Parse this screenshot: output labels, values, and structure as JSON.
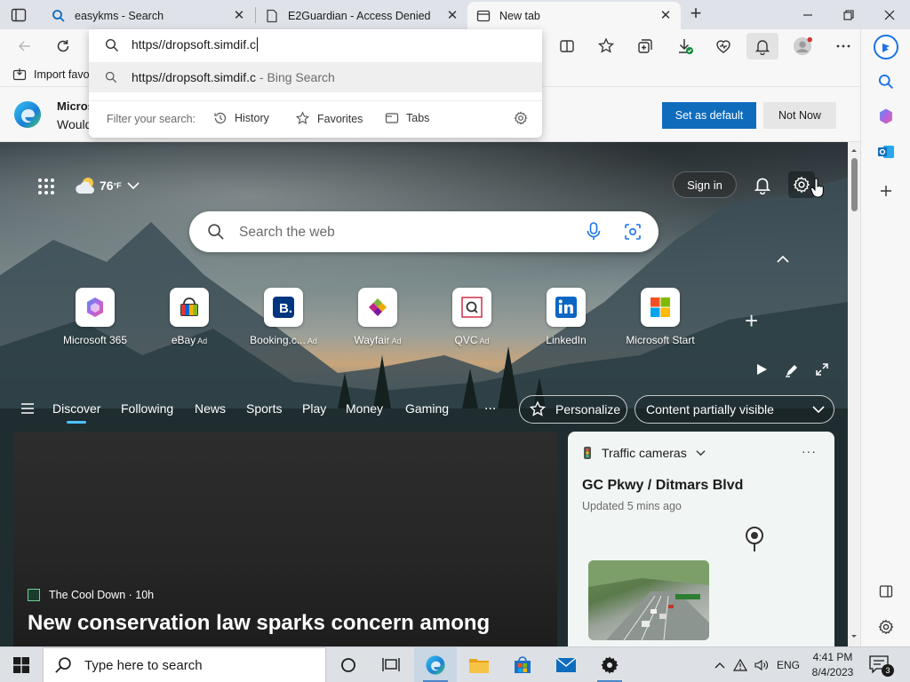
{
  "tabs": [
    {
      "label": "easykms - Search",
      "active": false
    },
    {
      "label": "E2Guardian - Access Denied",
      "active": false
    },
    {
      "label": "New tab",
      "active": true
    }
  ],
  "address": {
    "value": "https//dropsoft.simdif.c",
    "suggestion": "https//dropsoft.simdif.c",
    "suggestion_suffix": " - Bing Search",
    "filter_label": "Filter your search:",
    "filters": [
      "History",
      "Favorites",
      "Tabs"
    ]
  },
  "favorites_bar": {
    "import_label": "Import favo"
  },
  "banner": {
    "title": "Micros",
    "text": "Would",
    "set_default": "Set as default",
    "not_now": "Not Now"
  },
  "page": {
    "weather_temp": "76",
    "weather_unit": "°F",
    "sign_in": "Sign in",
    "search_placeholder": "Search the web",
    "tiles": [
      {
        "name": "Microsoft 365",
        "ad": ""
      },
      {
        "name": "eBay",
        "ad": "Ad"
      },
      {
        "name": "Booking.c...",
        "ad": "Ad"
      },
      {
        "name": "Wayfair",
        "ad": "Ad"
      },
      {
        "name": "QVC",
        "ad": "Ad"
      },
      {
        "name": "LinkedIn",
        "ad": ""
      },
      {
        "name": "Microsoft Start",
        "ad": ""
      }
    ],
    "feed_tabs": [
      "Discover",
      "Following",
      "News",
      "Sports",
      "Play",
      "Money",
      "Gaming"
    ],
    "feed_more": "...",
    "personalize": "Personalize",
    "content_visibility": "Content partially visible"
  },
  "news": {
    "source": "The Cool Down · 10h",
    "headline": "New conservation law sparks concern among"
  },
  "traffic": {
    "title": "Traffic cameras",
    "location": "GC Pkwy / Ditmars Blvd",
    "updated": "Updated 5 mins ago",
    "more": "···"
  },
  "taskbar": {
    "search_placeholder": "Type here to search",
    "language": "ENG",
    "time": "4:41 PM",
    "date": "8/4/2023",
    "notifications": "3"
  },
  "colors": {
    "accent": "#0f6cbd",
    "active_tab_indicator": "#4cc2ff",
    "titlebar": "#dfe3e9",
    "taskbar": "#dde1e6"
  }
}
